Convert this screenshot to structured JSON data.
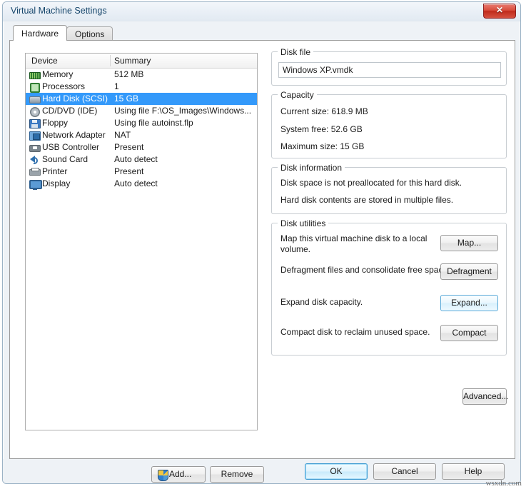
{
  "window": {
    "title": "Virtual Machine Settings",
    "close_label": "✕"
  },
  "tabs": [
    {
      "label": "Hardware",
      "active": true
    },
    {
      "label": "Options",
      "active": false
    }
  ],
  "device_list": {
    "columns": [
      "Device",
      "Summary"
    ],
    "rows": [
      {
        "icon": "memory-icon",
        "device": "Memory",
        "summary": "512 MB",
        "selected": false
      },
      {
        "icon": "processor-icon",
        "device": "Processors",
        "summary": "1",
        "selected": false
      },
      {
        "icon": "hard-disk-icon",
        "device": "Hard Disk (SCSI)",
        "summary": "15 GB",
        "selected": true
      },
      {
        "icon": "cd-dvd-icon",
        "device": "CD/DVD (IDE)",
        "summary": "Using file F:\\OS_Images\\Windows...",
        "selected": false
      },
      {
        "icon": "floppy-icon",
        "device": "Floppy",
        "summary": "Using file autoinst.flp",
        "selected": false
      },
      {
        "icon": "network-adapter-icon",
        "device": "Network Adapter",
        "summary": "NAT",
        "selected": false
      },
      {
        "icon": "usb-icon",
        "device": "USB Controller",
        "summary": "Present",
        "selected": false
      },
      {
        "icon": "sound-card-icon",
        "device": "Sound Card",
        "summary": "Auto detect",
        "selected": false
      },
      {
        "icon": "printer-icon",
        "device": "Printer",
        "summary": "Present",
        "selected": false
      },
      {
        "icon": "display-icon",
        "device": "Display",
        "summary": "Auto detect",
        "selected": false
      }
    ],
    "add_label": "Add...",
    "remove_label": "Remove"
  },
  "disk_file": {
    "legend": "Disk file",
    "value": "Windows XP.vmdk"
  },
  "capacity": {
    "legend": "Capacity",
    "current_size": "Current size: 618.9 MB",
    "system_free": "System free: 52.6 GB",
    "maximum_size": "Maximum size: 15 GB"
  },
  "disk_information": {
    "legend": "Disk information",
    "line1": "Disk space is not preallocated for this hard disk.",
    "line2": "Hard disk contents are stored in multiple files."
  },
  "disk_utilities": {
    "legend": "Disk utilities",
    "rows": [
      {
        "text": "Map this virtual machine disk to a local volume.",
        "button": "Map...",
        "highlighted": false
      },
      {
        "text": "Defragment files and consolidate free space.",
        "button": "Defragment",
        "highlighted": false
      },
      {
        "text": "Expand disk capacity.",
        "button": "Expand...",
        "highlighted": true
      },
      {
        "text": "Compact disk to reclaim unused space.",
        "button": "Compact",
        "highlighted": false
      }
    ]
  },
  "advanced_label": "Advanced...",
  "footer": {
    "ok": "OK",
    "cancel": "Cancel",
    "help": "Help"
  },
  "watermark": "wsxdn.com",
  "colors": {
    "selection_blue": "#3399fa",
    "arrow_red": "#e2443a",
    "title_text": "#16466b",
    "close_red": "#c02a1b"
  },
  "annotations": [
    {
      "name": "arrow-to-hard-disk",
      "points_to": "Hard Disk (SCSI) row"
    },
    {
      "name": "arrow-to-expand-button",
      "points_to": "Expand... button"
    }
  ]
}
